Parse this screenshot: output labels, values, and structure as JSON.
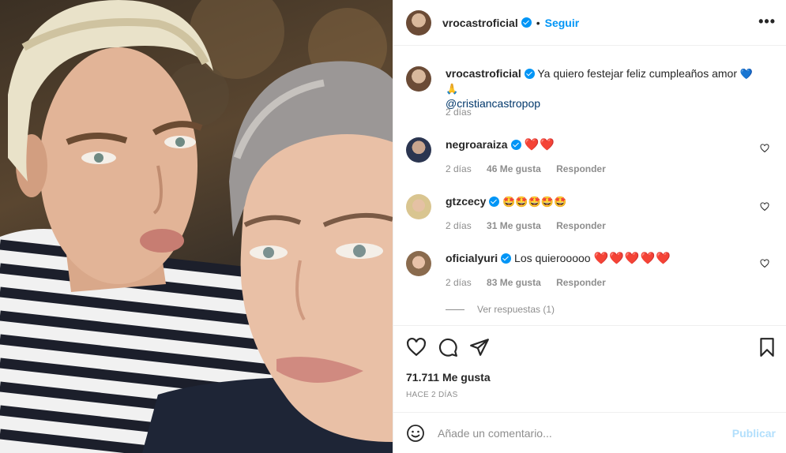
{
  "post": {
    "author": "vrocastroficial",
    "follow_label": "Seguir",
    "separator": "•",
    "more_label": "•••",
    "caption_text": "Ya quiero festejar feliz cumpleaños amor",
    "caption_emojis": "💙🙏",
    "caption_mention": "@cristiancastropop",
    "caption_time": "2 días"
  },
  "comments": [
    {
      "user": "negroaraiza",
      "text": "",
      "hearts": "❤️❤️",
      "time": "2 días",
      "likes": "46 Me gusta",
      "reply": "Responder"
    },
    {
      "user": "gtzcecy",
      "text": "",
      "emojis": "🤩🤩🤩🤩🤩",
      "time": "2 días",
      "likes": "31 Me gusta",
      "reply": "Responder"
    },
    {
      "user": "oficialyuri",
      "text": "Los quierooooo",
      "hearts": "❤️❤️❤️❤️❤️",
      "time": "2 días",
      "likes": "83 Me gusta",
      "reply": "Responder"
    }
  ],
  "view_replies": "Ver respuestas (1)",
  "likes_total": "71.711 Me gusta",
  "posted_ago": "HACE 2 DÍAS",
  "composer": {
    "placeholder": "Añade un comentario...",
    "publish": "Publicar"
  },
  "icons": {
    "like": "heart-outline-icon",
    "comment": "comment-bubble-icon",
    "share": "paper-plane-icon",
    "save": "bookmark-icon",
    "emoji": "smiley-icon"
  },
  "colors": {
    "accent": "#0095f6",
    "publish_disabled": "#b2dffc",
    "heart": "#e0245e"
  }
}
